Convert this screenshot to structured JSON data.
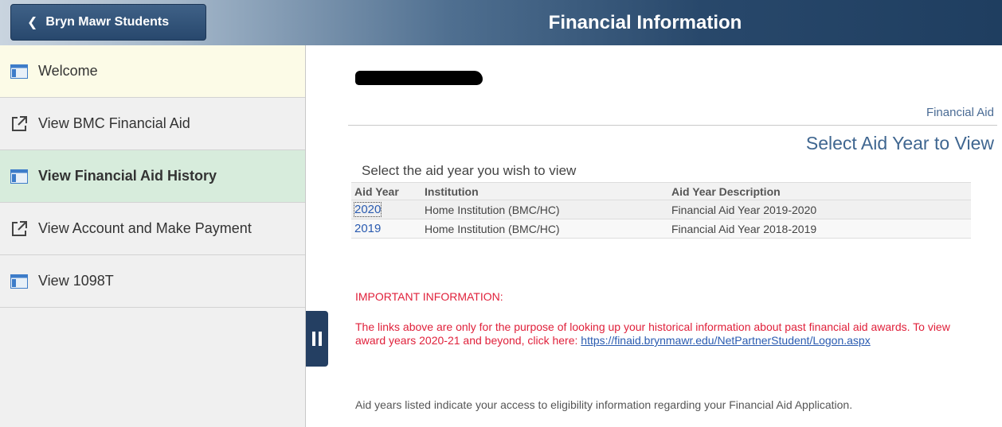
{
  "header": {
    "back_label": "Bryn Mawr Students",
    "title": "Financial Information"
  },
  "sidebar": {
    "items": [
      {
        "label": "Welcome",
        "icon": "page-icon"
      },
      {
        "label": "View BMC Financial Aid",
        "icon": "external-link-icon"
      },
      {
        "label": "View Financial Aid History",
        "icon": "page-icon",
        "active": true
      },
      {
        "label": "View Account and Make Payment",
        "icon": "external-link-icon"
      },
      {
        "label": "View 1098T",
        "icon": "page-icon"
      }
    ]
  },
  "main": {
    "section_label": "Financial Aid",
    "subtitle": "Select Aid Year to View",
    "instruction": "Select the aid year you wish to view",
    "table": {
      "headers": [
        "Aid Year",
        "Institution",
        "Aid Year Description"
      ],
      "rows": [
        {
          "year": "2020",
          "institution": "Home Institution (BMC/HC)",
          "description": "Financial Aid Year 2019-2020"
        },
        {
          "year": "2019",
          "institution": "Home Institution (BMC/HC)",
          "description": "Financial Aid Year 2018-2019"
        }
      ]
    },
    "important_heading": "IMPORTANT INFORMATION:",
    "note_text": "The links above are only for the purpose of looking up your historical information about past financial aid awards. To view award years 2020-21 and beyond, click here: ",
    "note_link": "https://finaid.brynmawr.edu/NetPartnerStudent/Logon.aspx",
    "footer_note": "Aid years listed indicate your access to eligibility information regarding your Financial Aid Application."
  },
  "colors": {
    "header_dark": "#1f3e60",
    "active_item": "#d7ecdc",
    "welcome_item": "#fcfbe7",
    "alert_red": "#e0213b",
    "link_blue": "#2a5bb0"
  }
}
